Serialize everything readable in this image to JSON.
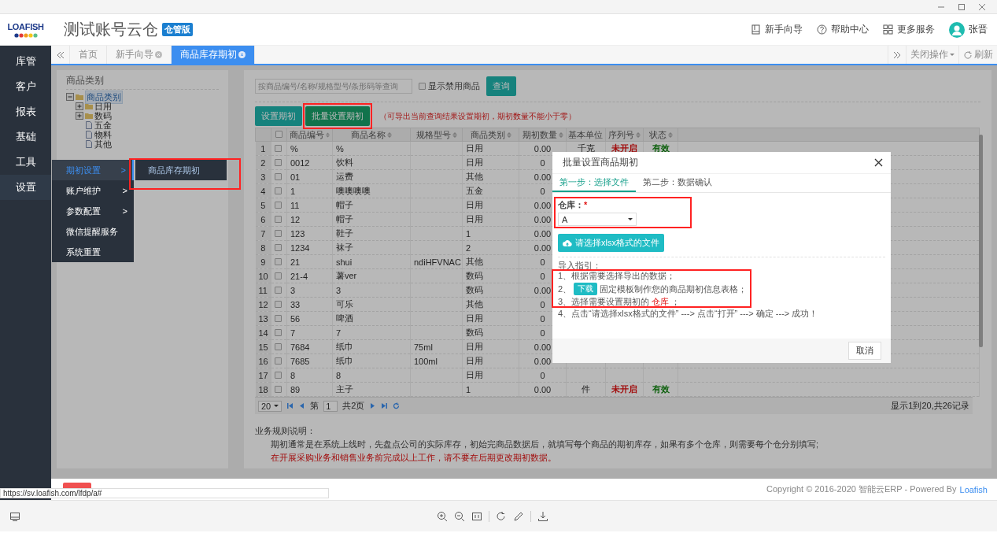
{
  "app": {
    "logo": "LOAFISH",
    "title": "测试账号云仓",
    "edition": "仓管版"
  },
  "header_links": [
    {
      "kind": "book",
      "label": "新手向导"
    },
    {
      "kind": "help",
      "label": "帮助中心"
    },
    {
      "kind": "grid",
      "label": "更多服务"
    }
  ],
  "user": {
    "name": "张晋"
  },
  "sidebar": {
    "items": [
      {
        "label": "库管",
        "selected": false
      },
      {
        "label": "客户",
        "selected": false
      },
      {
        "label": "报表",
        "selected": false
      },
      {
        "label": "基础",
        "selected": false
      },
      {
        "label": "工具",
        "selected": false
      },
      {
        "label": "设置",
        "selected": true
      }
    ]
  },
  "tabs": [
    {
      "label": "首页",
      "selected": false,
      "closable": false
    },
    {
      "label": "新手向导",
      "selected": false,
      "closable": true
    },
    {
      "label": "商品库存期初",
      "selected": true,
      "closable": true
    }
  ],
  "tab_tools": {
    "close_menu": "关闭操作",
    "refresh": "刷新"
  },
  "flyout": {
    "items": [
      {
        "label": "期初设置",
        "selected": true,
        "submenu": true
      },
      {
        "label": "账户维护",
        "selected": false,
        "submenu": true
      },
      {
        "label": "参数配置",
        "selected": false,
        "submenu": true
      },
      {
        "label": "微信提醒服务",
        "selected": false,
        "submenu": false
      },
      {
        "label": "系统重置",
        "selected": false,
        "submenu": false
      }
    ],
    "arrow": ">"
  },
  "submenu": {
    "items": [
      {
        "label": "商品库存期初"
      }
    ]
  },
  "category_panel": {
    "title": "商品类别",
    "tree": [
      {
        "label": "商品类别",
        "selected": true,
        "expanded": true,
        "children": [
          {
            "label": "日用",
            "selected": false,
            "expanded": false
          },
          {
            "label": "数码",
            "selected": false,
            "expanded": false
          },
          {
            "label": "五金",
            "selected": false
          },
          {
            "label": "物料",
            "selected": false
          },
          {
            "label": "其他",
            "selected": false
          }
        ]
      }
    ]
  },
  "search": {
    "placeholder": "按商品编号/名称/规格型号/条形码等查询",
    "show_disabled": {
      "label": "显示禁用商品",
      "checked": false
    },
    "button": "查询"
  },
  "actions": {
    "buttons": [
      {
        "label": "设置期初",
        "selected": false
      },
      {
        "label": "批量设置期初",
        "selected": true
      }
    ],
    "hint": "（可导出当前查询结果设置期初，期初数量不能小于零）"
  },
  "table": {
    "select_all": false,
    "columns": [
      "商品编号",
      "商品名称",
      "规格型号",
      "商品类别",
      "期初数量",
      "基本单位",
      "序列号",
      "状态"
    ],
    "rows": [
      {
        "no": "1",
        "checked": false,
        "code": "%",
        "name": "%",
        "category": "日用",
        "qty": "0.00",
        "unit": "千克",
        "serial": "未开启",
        "status": "有效"
      },
      {
        "no": "2",
        "checked": false,
        "code": "0012",
        "name": "饮料",
        "category": "日用",
        "qty": "0"
      },
      {
        "no": "3",
        "checked": false,
        "code": "01",
        "name": "运费",
        "category": "其他",
        "qty": "0.00"
      },
      {
        "no": "4",
        "checked": false,
        "code": "1",
        "name": "噢噢噢噢",
        "category": "五金",
        "qty": "0"
      },
      {
        "no": "5",
        "checked": false,
        "code": "11",
        "name": "帽子",
        "category": "日用",
        "qty": "0.00"
      },
      {
        "no": "6",
        "checked": false,
        "code": "12",
        "name": "帽子",
        "category": "日用",
        "qty": "0.00"
      },
      {
        "no": "7",
        "checked": false,
        "code": "123",
        "name": "鞋子",
        "category": "1",
        "qty": "0.00"
      },
      {
        "no": "8",
        "checked": false,
        "code": "1234",
        "name": "袜子",
        "category": "2",
        "qty": "0.00"
      },
      {
        "no": "9",
        "checked": false,
        "code": "21",
        "name": "shui",
        "spec": "ndiHFVNAC",
        "category": "其他",
        "qty": "0"
      },
      {
        "no": "10",
        "checked": false,
        "code": "21-4",
        "name": "薯ver",
        "category": "数码",
        "qty": "0"
      },
      {
        "no": "11",
        "checked": false,
        "code": "3",
        "name": "3",
        "category": "数码",
        "qty": "0.00"
      },
      {
        "no": "12",
        "checked": false,
        "code": "33",
        "name": "可乐",
        "category": "其他",
        "qty": "0"
      },
      {
        "no": "13",
        "checked": false,
        "code": "56",
        "name": "啤酒",
        "category": "日用",
        "qty": "0"
      },
      {
        "no": "14",
        "checked": false,
        "code": "7",
        "name": "7",
        "category": "数码",
        "qty": "0"
      },
      {
        "no": "15",
        "checked": false,
        "code": "7684",
        "name": "纸巾",
        "spec": "75ml",
        "category": "日用",
        "qty": "0.00"
      },
      {
        "no": "16",
        "checked": false,
        "code": "7685",
        "name": "纸巾",
        "spec": "100ml",
        "category": "日用",
        "qty": "0.00"
      },
      {
        "no": "17",
        "checked": false,
        "code": "8",
        "name": "8",
        "category": "日用",
        "qty": "0"
      },
      {
        "no": "18",
        "checked": false,
        "code": "89",
        "name": "主子",
        "category": "1",
        "qty": "0.00",
        "unit": "件",
        "serial": "未开启",
        "status": "有效"
      }
    ]
  },
  "pager": {
    "page_size": "20",
    "page_prefix": "第",
    "page": "1",
    "total_pages": "共2页",
    "summary": "显示1到20,共26记录"
  },
  "rules": {
    "title": "业务规则说明：",
    "lines": [
      {
        "text": "期初通常是在系统上线时，先盘点公司的实际库存，初始完商品数据后，就填写每个商品的期初库存，如果有多个仓库，则需要每个仓分别填写;",
        "emphasis": false
      },
      {
        "text": "在开展采购业务和销售业务前完成以上工作，请不要在后期更改期初数据。",
        "emphasis": true
      }
    ]
  },
  "modal": {
    "title": "批量设置商品期初",
    "steps": [
      {
        "label": "第一步：选择文件",
        "selected": true
      },
      {
        "label": "第二步：数据确认",
        "selected": false
      }
    ],
    "warehouse": {
      "label": "仓库：",
      "required_mark": "*",
      "value": "A"
    },
    "upload_button": "请选择xlsx格式的文件",
    "guide_title": "导入指引：",
    "guide": [
      {
        "kind": "text",
        "parts": [
          {
            "text": "1、根据需要选择导出的数据；",
            "emphasis": false
          }
        ]
      },
      {
        "kind": "download",
        "prefix": "2、",
        "button": "下载",
        "text": "固定模板制作您的商品期初信息表格；"
      },
      {
        "kind": "text",
        "parts": [
          {
            "text": "3、选择需要设置期初的",
            "emphasis": false
          },
          {
            "text": "仓库",
            "emphasis": true
          },
          {
            "text": "；",
            "emphasis": false
          }
        ]
      },
      {
        "kind": "text",
        "parts": [
          {
            "text": "4、点击“请选择xlsx格式的文件” ---> 点击“打开” ---> 确定 ---> 成功！",
            "emphasis": false
          }
        ]
      }
    ],
    "cancel": "取消"
  },
  "footer": {
    "copyright": "Copyright © 2016-2020 智能云ERP - Powered By",
    "link": "Loafish"
  },
  "status_url": "https://sv.loafish.com/lfdp/a#"
}
